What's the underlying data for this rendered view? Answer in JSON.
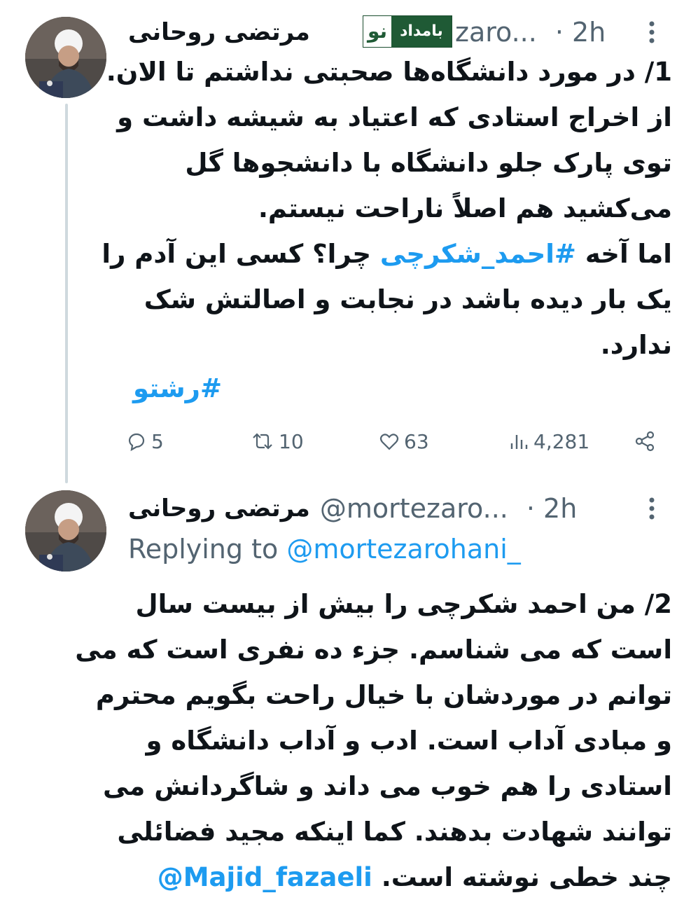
{
  "tweets": [
    {
      "name": "مرتضی روحانی",
      "handle": "zaro...",
      "time": "· 2h",
      "badge": {
        "main": "بامداد",
        "prefix": "نو"
      },
      "body_lines": [
        "1/ در مورد دانشگاه‌ها صحبتی نداشتم تا الان.",
        "از اخراج استادی که اعتیاد به شیشه داشت و",
        "توی پارک جلو دانشگاه با دانشجوها گل",
        "می‌کشید هم اصلاً ناراحت نیستم.",
        "اما آخه #احمد_شکرچی چرا؟ کسی این آدم را",
        "یک بار دیده باشد در نجابت و اصالتش شک",
        "ندارد."
      ],
      "body_hashtag": "#احمد_شکرچی",
      "hashtag": "#رشتو",
      "stats": {
        "replies": "5",
        "retweets": "10",
        "likes": "63",
        "views": "4,281"
      }
    },
    {
      "name": "مرتضی روحانی",
      "handle": "@mortezaro...",
      "time": "· 2h",
      "replying_label": "Replying to",
      "replying_handle": "@mortezarohani_",
      "body_lines": [
        "2/ من احمد شکرچی را بیش از بیست سال",
        "است که می شناسم. جزء ده نفری است که می",
        "توانم در موردشان با خیال راحت بگویم محترم",
        "و مبادی آداب است. ادب و آداب دانشگاه و",
        "استادی را هم خوب می داند و شاگردانش می",
        "توانند شهادت بدهند. کما اینکه مجید فضائلی",
        "چند خطی نوشته است."
      ],
      "mention": "@Majid_fazaeli"
    }
  ]
}
